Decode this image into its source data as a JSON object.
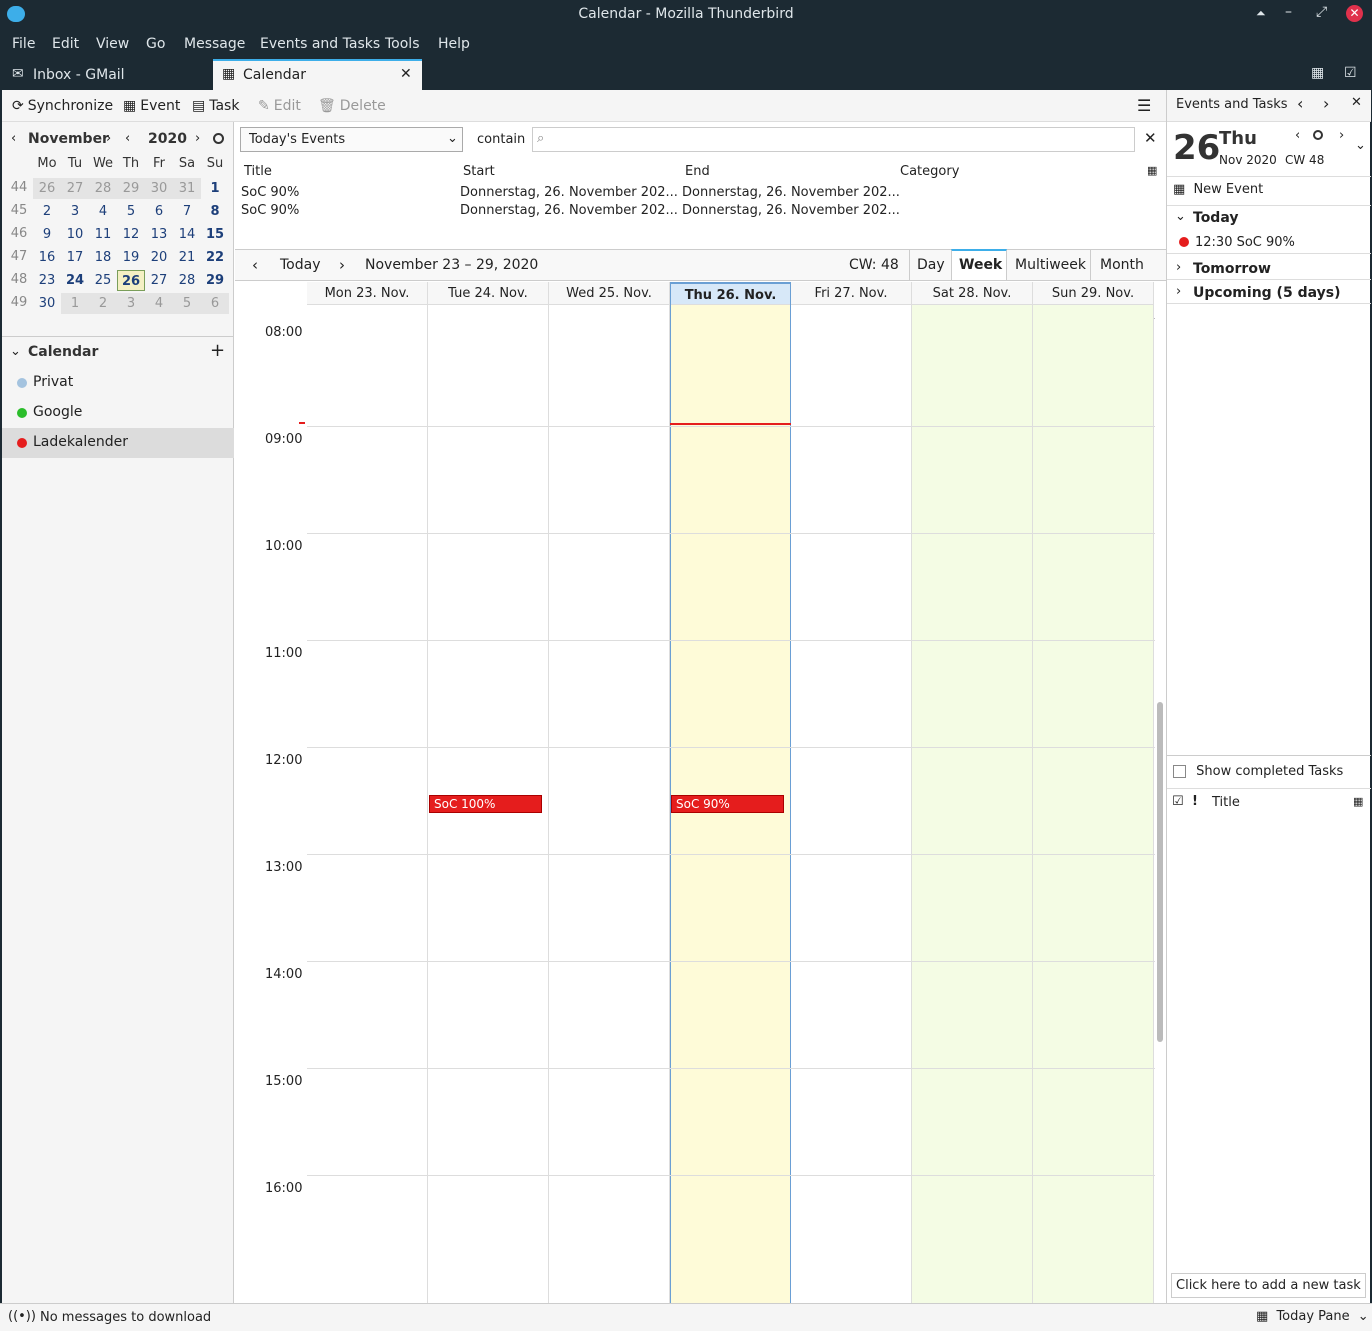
{
  "window": {
    "title": "Calendar - Mozilla Thunderbird"
  },
  "menu": [
    "File",
    "Edit",
    "View",
    "Go",
    "Message",
    "Events and Tasks",
    "Tools",
    "Help"
  ],
  "tabs": [
    {
      "label": "Inbox - GMail"
    },
    {
      "label": "Calendar"
    }
  ],
  "toolbar": {
    "synchronize": "Synchronize",
    "event": "Event",
    "task": "Task",
    "edit": "Edit",
    "delete": "Delete"
  },
  "minimonth": {
    "month": "November",
    "year": "2020",
    "weekday_headers": [
      "Mo",
      "Tu",
      "We",
      "Th",
      "Fr",
      "Sa",
      "Su"
    ],
    "weeks": [
      {
        "wk": "44",
        "days": [
          "26",
          "27",
          "28",
          "29",
          "30",
          "31",
          "1"
        ]
      },
      {
        "wk": "45",
        "days": [
          "2",
          "3",
          "4",
          "5",
          "6",
          "7",
          "8"
        ]
      },
      {
        "wk": "46",
        "days": [
          "9",
          "10",
          "11",
          "12",
          "13",
          "14",
          "15"
        ]
      },
      {
        "wk": "47",
        "days": [
          "16",
          "17",
          "18",
          "19",
          "20",
          "21",
          "22"
        ]
      },
      {
        "wk": "48",
        "days": [
          "23",
          "24",
          "25",
          "26",
          "27",
          "28",
          "29"
        ]
      },
      {
        "wk": "49",
        "days": [
          "30",
          "1",
          "2",
          "3",
          "4",
          "5",
          "6"
        ]
      }
    ],
    "today": "26"
  },
  "calendars": {
    "header": "Calendar",
    "items": [
      {
        "name": "Privat",
        "color": "#a4c3df"
      },
      {
        "name": "Google",
        "color": "#2bbd2b"
      },
      {
        "name": "Ladekalender",
        "color": "#e51d1d"
      }
    ]
  },
  "filter": {
    "selected": "Today's Events",
    "contain_label": "contain",
    "search_value": ""
  },
  "event_list": {
    "columns": [
      "Title",
      "Start",
      "End",
      "Category"
    ],
    "rows": [
      {
        "title": "SoC 90%",
        "start": "Donnerstag, 26. November 202...",
        "end": "Donnerstag, 26. November 202...",
        "category": ""
      },
      {
        "title": "SoC 90%",
        "start": "Donnerstag, 26. November 202...",
        "end": "Donnerstag, 26. November 202...",
        "category": ""
      }
    ]
  },
  "nav": {
    "today": "Today",
    "range": "November 23 – 29, 2020",
    "cw": "CW: 48",
    "views": [
      "Day",
      "Week",
      "Multiweek",
      "Month"
    ],
    "active_view": "Week"
  },
  "week": {
    "days": [
      "Mon 23. Nov.",
      "Tue 24. Nov.",
      "Wed 25. Nov.",
      "Thu 26. Nov.",
      "Fri 27. Nov.",
      "Sat 28. Nov.",
      "Sun 29. Nov."
    ],
    "hours": [
      "08:00",
      "09:00",
      "10:00",
      "11:00",
      "12:00",
      "13:00",
      "14:00",
      "15:00",
      "16:00"
    ],
    "events": [
      {
        "title": "SoC 100%",
        "day": 1,
        "time": "12:30"
      },
      {
        "title": "SoC 90%",
        "day": 3,
        "time": "12:30"
      }
    ]
  },
  "today_pane": {
    "header": "Events and Tasks",
    "day_number": "26",
    "weekday": "Thu",
    "month_year": "Nov 2020",
    "cw": "CW 48",
    "new_event": "New Event",
    "sections": [
      {
        "label": "Today"
      },
      {
        "label": "Tomorrow"
      },
      {
        "label": "Upcoming (5 days)"
      }
    ],
    "today_item": "12:30 SoC 90%",
    "show_completed": "Show completed Tasks",
    "tasks_title": "Title",
    "new_task_placeholder": "Click here to add a new task"
  },
  "status": {
    "message": "No messages to download",
    "today_pane_button": "Today Pane"
  }
}
